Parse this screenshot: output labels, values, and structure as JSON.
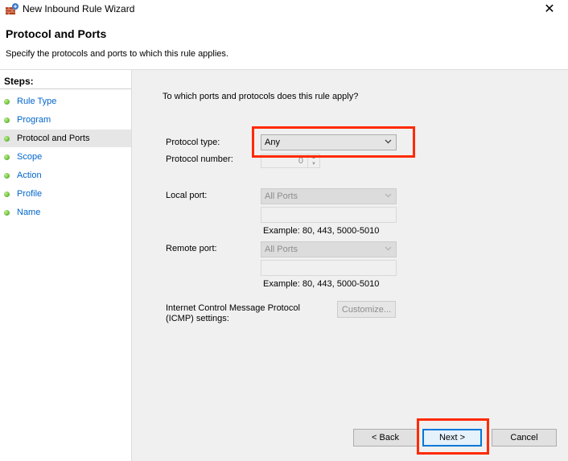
{
  "window": {
    "title": "New Inbound Rule Wizard",
    "close_glyph": "✕"
  },
  "header": {
    "title": "Protocol and Ports",
    "subtitle": "Specify the protocols and ports to which this rule applies."
  },
  "steps": {
    "label": "Steps:",
    "items": [
      {
        "label": "Rule Type",
        "current": false
      },
      {
        "label": "Program",
        "current": false
      },
      {
        "label": "Protocol and Ports",
        "current": true
      },
      {
        "label": "Scope",
        "current": false
      },
      {
        "label": "Action",
        "current": false
      },
      {
        "label": "Profile",
        "current": false
      },
      {
        "label": "Name",
        "current": false
      }
    ]
  },
  "form": {
    "question": "To which ports and protocols does this rule apply?",
    "protocol_type": {
      "label": "Protocol type:",
      "value": "Any"
    },
    "protocol_number": {
      "label": "Protocol number:",
      "value": "0"
    },
    "local_port": {
      "label": "Local port:",
      "value": "All Ports",
      "example": "Example: 80, 443, 5000-5010"
    },
    "remote_port": {
      "label": "Remote port:",
      "value": "All Ports",
      "example": "Example: 80, 443, 5000-5010"
    },
    "icmp": {
      "label_line1": "Internet Control Message Protocol",
      "label_line2": "(ICMP) settings:",
      "button": "Customize..."
    }
  },
  "buttons": {
    "back": "< Back",
    "next": "Next >",
    "cancel": "Cancel"
  },
  "colors": {
    "highlight": "#ff2a00",
    "link": "#0066cc",
    "accent": "#0078d7"
  }
}
